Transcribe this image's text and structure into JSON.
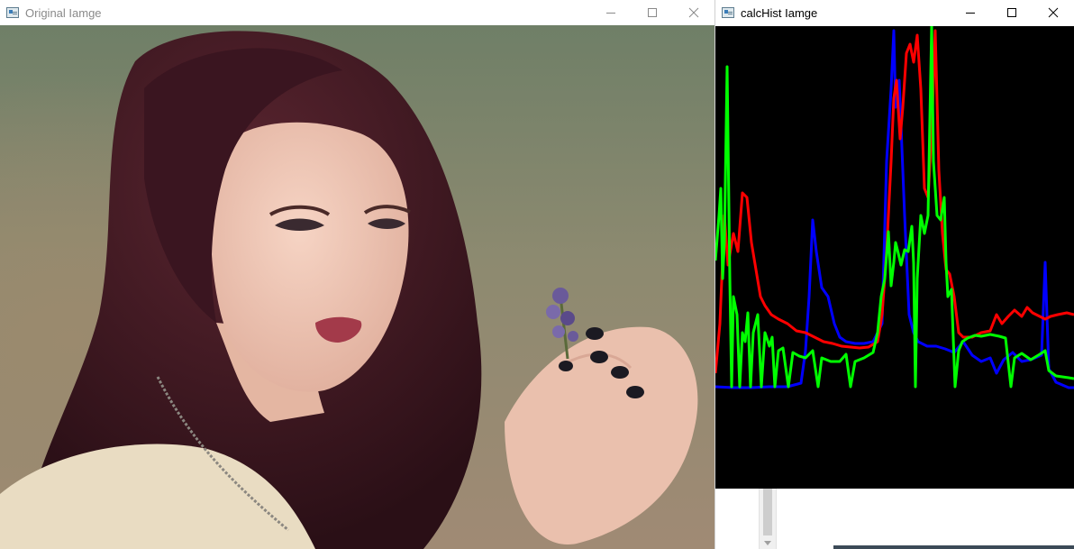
{
  "windows": {
    "original": {
      "title": "Original Iamge",
      "icon": "opencv-window-icon"
    },
    "hist": {
      "title": "calcHist Iamge",
      "icon": "opencv-window-icon"
    }
  },
  "controls": [
    "minimize-icon",
    "maximize-icon",
    "close-icon"
  ],
  "colors": {
    "hist_background": "#000000",
    "blue_channel": "#0000ff",
    "green_channel": "#00ff00",
    "red_channel": "#ff0000"
  }
}
